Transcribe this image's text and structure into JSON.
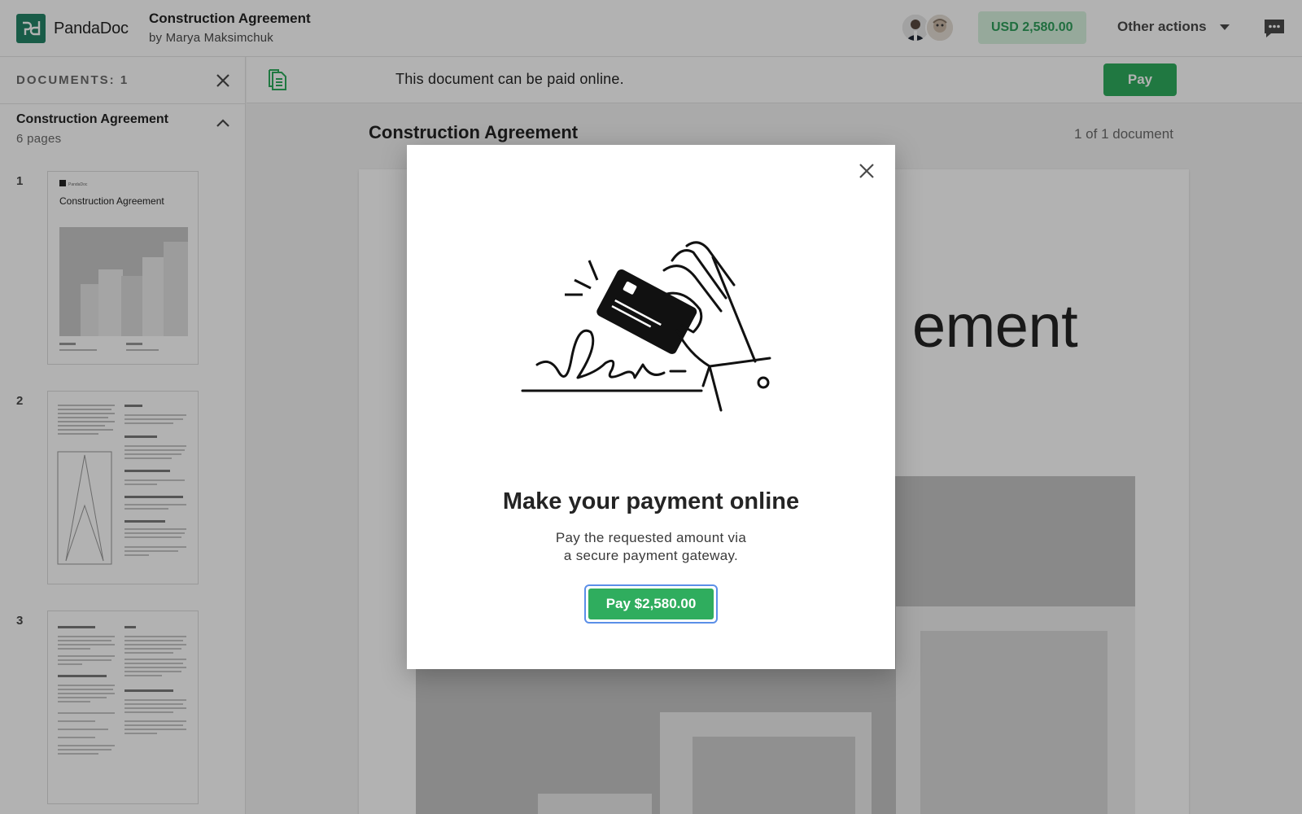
{
  "app": {
    "brand": "PandaDoc",
    "document_title": "Construction Agreement",
    "author": "by Marya Maksimchuk",
    "amount": "USD 2,580.00",
    "other_actions_label": "Other actions"
  },
  "sidebar": {
    "documents_count_label": "DOCUMENTS: 1",
    "group_title": "Construction Agreement",
    "group_pages": "6 pages",
    "pages": [
      {
        "number": "1",
        "thumb_title": "Construction Agreement",
        "thumb_brand": "PandaDoc"
      },
      {
        "number": "2"
      },
      {
        "number": "3"
      }
    ]
  },
  "notice": {
    "text": "This document can be paid online.",
    "pay_label": "Pay"
  },
  "document": {
    "title": "Construction Agreement",
    "count": "1 of 1 document",
    "page_heading_visible": "ement"
  },
  "modal": {
    "title": "Make your payment online",
    "subtitle_line1": "Pay the requested amount via",
    "subtitle_line2": "a secure payment gateway.",
    "pay_button_label": "Pay $2,580.00"
  },
  "colors": {
    "brand_green": "#248567",
    "button_green": "#2fad5e",
    "badge_bg": "#d7f3df",
    "focus_ring": "#5b8fe8"
  },
  "icons": [
    "pandadoc-logo-icon",
    "chat-icon",
    "close-icon",
    "chevron-up-icon",
    "document-icon",
    "dropdown-caret-icon",
    "credit-card-hand-illustration"
  ]
}
